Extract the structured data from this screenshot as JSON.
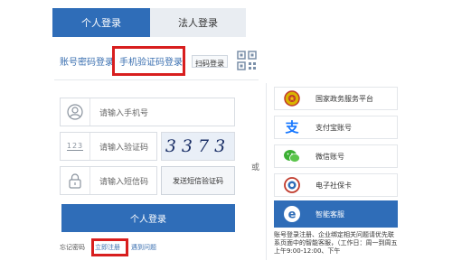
{
  "tabs": {
    "personal": "个人登录",
    "legal": "法人登录"
  },
  "login_methods": {
    "account_password": "账号密码登录",
    "phone_code": "手机验证码登录",
    "scan_code": "扫码登录"
  },
  "form": {
    "phone_placeholder": "请输入手机号",
    "captcha_placeholder": "请输入验证码",
    "captcha_text": "3373",
    "sms_placeholder": "请输入短信码",
    "send_sms_label": "发送短信验证码",
    "login_button": "个人登录",
    "captcha_icon_text": "123"
  },
  "links": {
    "forgot": "忘记密码",
    "register": "立即注册",
    "problem": "遇到问题"
  },
  "divider_text": "或",
  "alt_logins": [
    {
      "label": "国家政务服务平台",
      "icon": "national-emblem-icon"
    },
    {
      "label": "支付宝账号",
      "icon": "alipay-icon"
    },
    {
      "label": "微信账号",
      "icon": "wechat-icon"
    },
    {
      "label": "电子社保卡",
      "icon": "social-security-card-icon"
    },
    {
      "label": "智能客服",
      "icon": "customer-service-icon"
    }
  ],
  "note": "账号登录注册、企业绑定相关问题请优先联系页面中的智能客服，（工作日：周一到周五上午9:00-12:00、下午",
  "colors": {
    "primary": "#2f6db8",
    "highlight": "#d81e1e"
  }
}
